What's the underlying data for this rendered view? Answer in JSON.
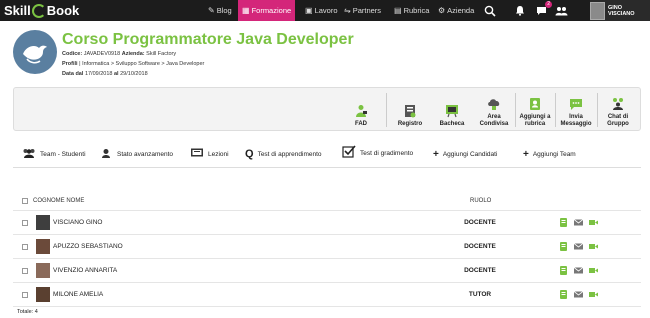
{
  "topbar": {
    "logo_left": "Skill",
    "logo_right": "Book",
    "nav": [
      {
        "label": "Blog",
        "icon": "edit-icon"
      },
      {
        "label": "Formazione",
        "icon": "grid-icon",
        "active": true
      },
      {
        "label": "Lavoro",
        "icon": "briefcase-icon"
      },
      {
        "label": "Partners",
        "icon": "partners-icon"
      },
      {
        "label": "Rubrica",
        "icon": "address-book-icon"
      },
      {
        "label": "Azienda",
        "icon": "gear-icon"
      }
    ],
    "notif_badge": "2",
    "user_name": "GINO VISCIANO",
    "accent": "#d4267a"
  },
  "course": {
    "title": "Corso Programmatore Java Developer",
    "code_label": "Codice:",
    "code": "JAVADEV0918",
    "company_label": "Azienda:",
    "company": "Skill Factory",
    "profile_label": "Profili",
    "profile": "| Informatica > Sviluppo Software > Java Developer",
    "date_label": "Data dal",
    "date_from": "17/09/2018",
    "date_al": "al",
    "date_to": "29/10/2018",
    "title_color": "#7bc242"
  },
  "actions": [
    {
      "label": "FAD",
      "icon": "fad-icon"
    },
    {
      "label": "Registro",
      "icon": "register-icon"
    },
    {
      "label": "Bacheca",
      "icon": "board-icon"
    },
    {
      "label": "Area Condivisa",
      "icon": "cloud-icon"
    },
    {
      "label": "Aggiungi a rubrica",
      "icon": "add-contact-icon"
    },
    {
      "label": "Invia Messaggio",
      "icon": "chat-icon"
    },
    {
      "label": "Chat di Gruppo",
      "icon": "group-chat-icon"
    }
  ],
  "tabs": [
    {
      "label": "Team - Studenti",
      "icon": "team-icon"
    },
    {
      "label": "Stato avanzamento",
      "icon": "progress-icon"
    },
    {
      "label": "Lezioni",
      "icon": "lessons-icon"
    },
    {
      "label": "Test di apprendimento",
      "icon": "q-icon"
    },
    {
      "label": "Test di gradimento",
      "icon": "checkbox-icon"
    },
    {
      "label": "Aggiungi Candidati",
      "icon": "plus-icon"
    },
    {
      "label": "Aggiungi Team",
      "icon": "plus-icon"
    }
  ],
  "table": {
    "col_name": "COGNOME NOME",
    "col_role": "RUOLO",
    "rows": [
      {
        "name": "VISCIANO GINO",
        "role": "DOCENTE"
      },
      {
        "name": "APUZZO SEBASTIANO",
        "role": "DOCENTE"
      },
      {
        "name": "VIVENZIO ANNARITA",
        "role": "DOCENTE"
      },
      {
        "name": "MILONE AMELIA",
        "role": "TUTOR"
      }
    ],
    "total": "Totale: 4"
  }
}
